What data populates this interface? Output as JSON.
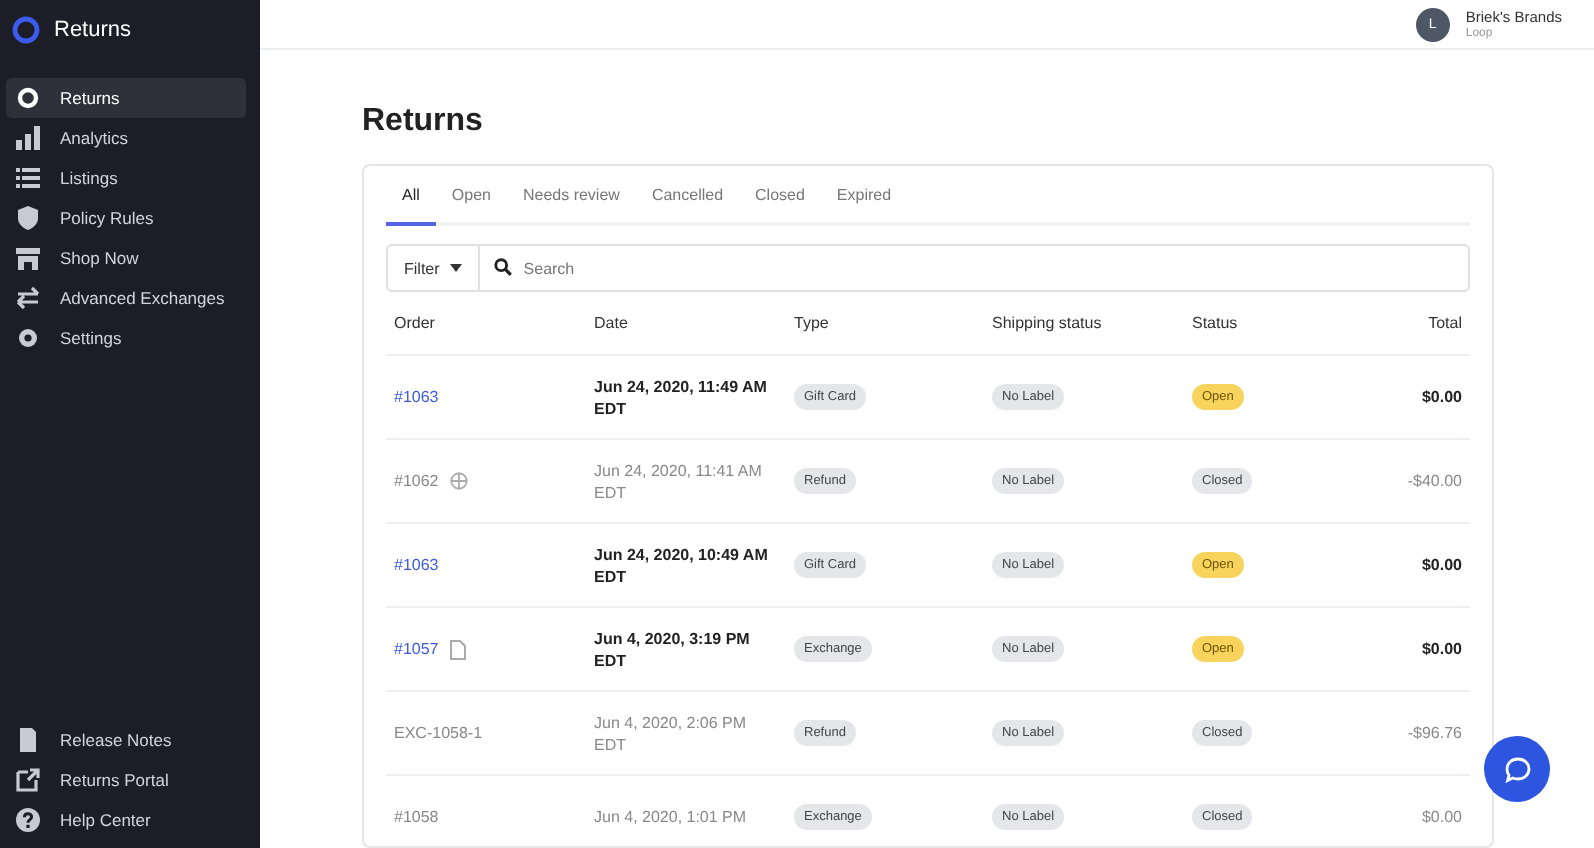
{
  "app": {
    "title": "Returns"
  },
  "sidebar": {
    "items": [
      {
        "label": "Returns",
        "selected": true
      },
      {
        "label": "Analytics",
        "selected": false
      },
      {
        "label": "Listings",
        "selected": false
      },
      {
        "label": "Policy Rules",
        "selected": false
      },
      {
        "label": "Shop Now",
        "selected": false
      },
      {
        "label": "Advanced Exchanges",
        "selected": false
      },
      {
        "label": "Settings",
        "selected": false
      }
    ],
    "footer_items": [
      {
        "label": "Release Notes"
      },
      {
        "label": "Returns Portal"
      },
      {
        "label": "Help Center"
      }
    ]
  },
  "account": {
    "initial": "L",
    "name": "Briek's Brands",
    "subtitle": "Loop"
  },
  "page_title": "Returns",
  "tabs": [
    {
      "label": "All",
      "selected": true
    },
    {
      "label": "Open",
      "selected": false
    },
    {
      "label": "Needs review",
      "selected": false
    },
    {
      "label": "Cancelled",
      "selected": false
    },
    {
      "label": "Closed",
      "selected": false
    },
    {
      "label": "Expired",
      "selected": false
    }
  ],
  "filter": {
    "label": "Filter"
  },
  "search": {
    "placeholder": "Search"
  },
  "table": {
    "columns": [
      "Order",
      "Date",
      "Type",
      "Shipping status",
      "Status",
      "Total"
    ],
    "rows": [
      {
        "order": "#1063",
        "linked": true,
        "kind": "plain",
        "date": "Jun 24, 2020, 11:49 AM",
        "tz": "EDT",
        "type": "Gift Card",
        "shipping": "No Label",
        "status": "Open",
        "active": true,
        "total": "$0.00"
      },
      {
        "order": "#1062",
        "linked": false,
        "kind": "globe",
        "date": "Jun 24, 2020, 11:41 AM",
        "tz": "EDT",
        "type": "Refund",
        "shipping": "No Label",
        "status": "Closed",
        "active": false,
        "total": "-$40.00"
      },
      {
        "order": "#1063",
        "linked": true,
        "kind": "plain",
        "date": "Jun 24, 2020, 10:49 AM",
        "tz": "EDT",
        "type": "Gift Card",
        "shipping": "No Label",
        "status": "Open",
        "active": true,
        "total": "$0.00"
      },
      {
        "order": "#1057",
        "linked": true,
        "kind": "document",
        "date": "Jun 4, 2020, 3:19 PM",
        "tz": "EDT",
        "type": "Exchange",
        "shipping": "No Label",
        "status": "Open",
        "active": true,
        "total": "$0.00"
      },
      {
        "order": "EXC-1058-1",
        "linked": false,
        "kind": "plain",
        "date": "Jun 4, 2020, 2:06 PM",
        "tz": "EDT",
        "type": "Refund",
        "shipping": "No Label",
        "status": "Closed",
        "active": false,
        "total": "-$96.76"
      },
      {
        "order": "#1058",
        "linked": false,
        "kind": "plain",
        "date": "Jun 4, 2020, 1:01 PM",
        "type": "Exchange",
        "shipping": "No Label",
        "status": "Closed",
        "active": false,
        "total": "$0.00"
      }
    ]
  }
}
